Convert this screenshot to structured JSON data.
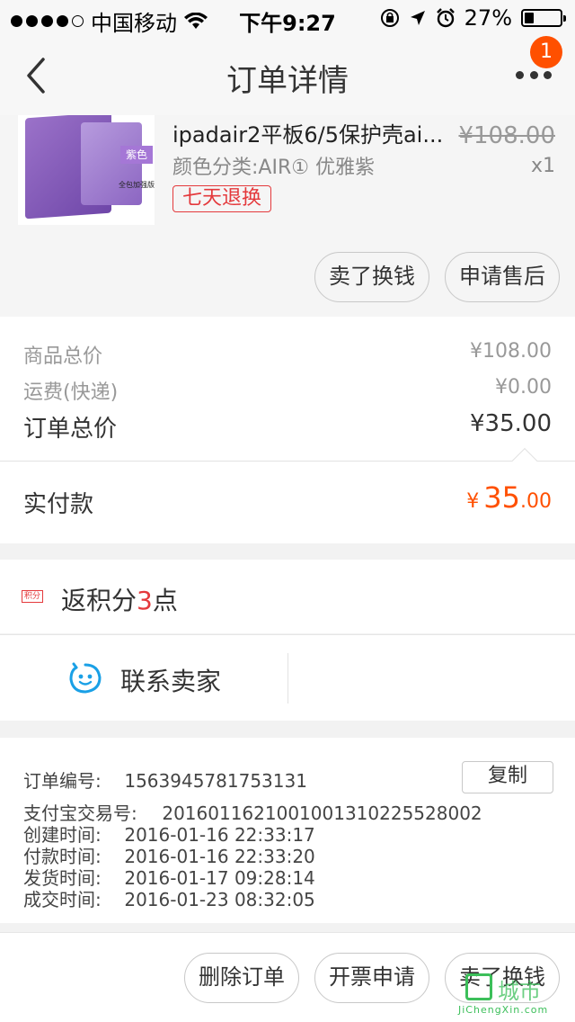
{
  "status_bar": {
    "carrier": "中国移动",
    "time": "下午9:27",
    "battery_percent": "27%",
    "battery_level": 0.27
  },
  "nav": {
    "title": "订单详情",
    "badge_count": "1"
  },
  "product": {
    "name": "ipadair2平板6/5保护壳ai...",
    "original_price": "¥108.00",
    "sku": "颜色分类:AIR① 优雅紫",
    "quantity": "x1",
    "return_tag": "七天退换",
    "image_tag": "紫色",
    "image_caption": "全包加强版",
    "buttons": [
      "卖了换钱",
      "申请售后"
    ]
  },
  "summary": {
    "goods_total_label": "商品总价",
    "goods_total_value": "¥108.00",
    "shipping_label": "运费(快递)",
    "shipping_value": "¥0.00",
    "order_total_label": "订单总价",
    "order_total_value": "¥35.00",
    "paid_label": "实付款",
    "paid_currency": "¥",
    "paid_integer": "35",
    "paid_decimal": ".00"
  },
  "points": {
    "icon_text": "积分",
    "prefix": "返积分",
    "number": "3",
    "suffix": "点"
  },
  "contact": {
    "label": "联系卖家"
  },
  "order_info": {
    "rows": [
      {
        "key": "订单编号:",
        "value": "1563945781753131"
      },
      {
        "key": "支付宝交易号:",
        "value": "2016011621001001310225528002"
      },
      {
        "key": "创建时间:",
        "value": "2016-01-16 22:33:17"
      },
      {
        "key": "付款时间:",
        "value": "2016-01-16 22:33:20"
      },
      {
        "key": "发货时间:",
        "value": "2016-01-17 09:28:14"
      },
      {
        "key": "成交时间:",
        "value": "2016-01-23 08:32:05"
      }
    ],
    "copy_label": "复制"
  },
  "bottom_actions": [
    "删除订单",
    "开票申请",
    "卖了换钱"
  ],
  "watermark": {
    "text": "城市",
    "sub": "JiChengXin.com"
  },
  "colors": {
    "accent": "#ff5000",
    "tag_red": "#e4393c",
    "contact_blue": "#1aa0e6"
  }
}
